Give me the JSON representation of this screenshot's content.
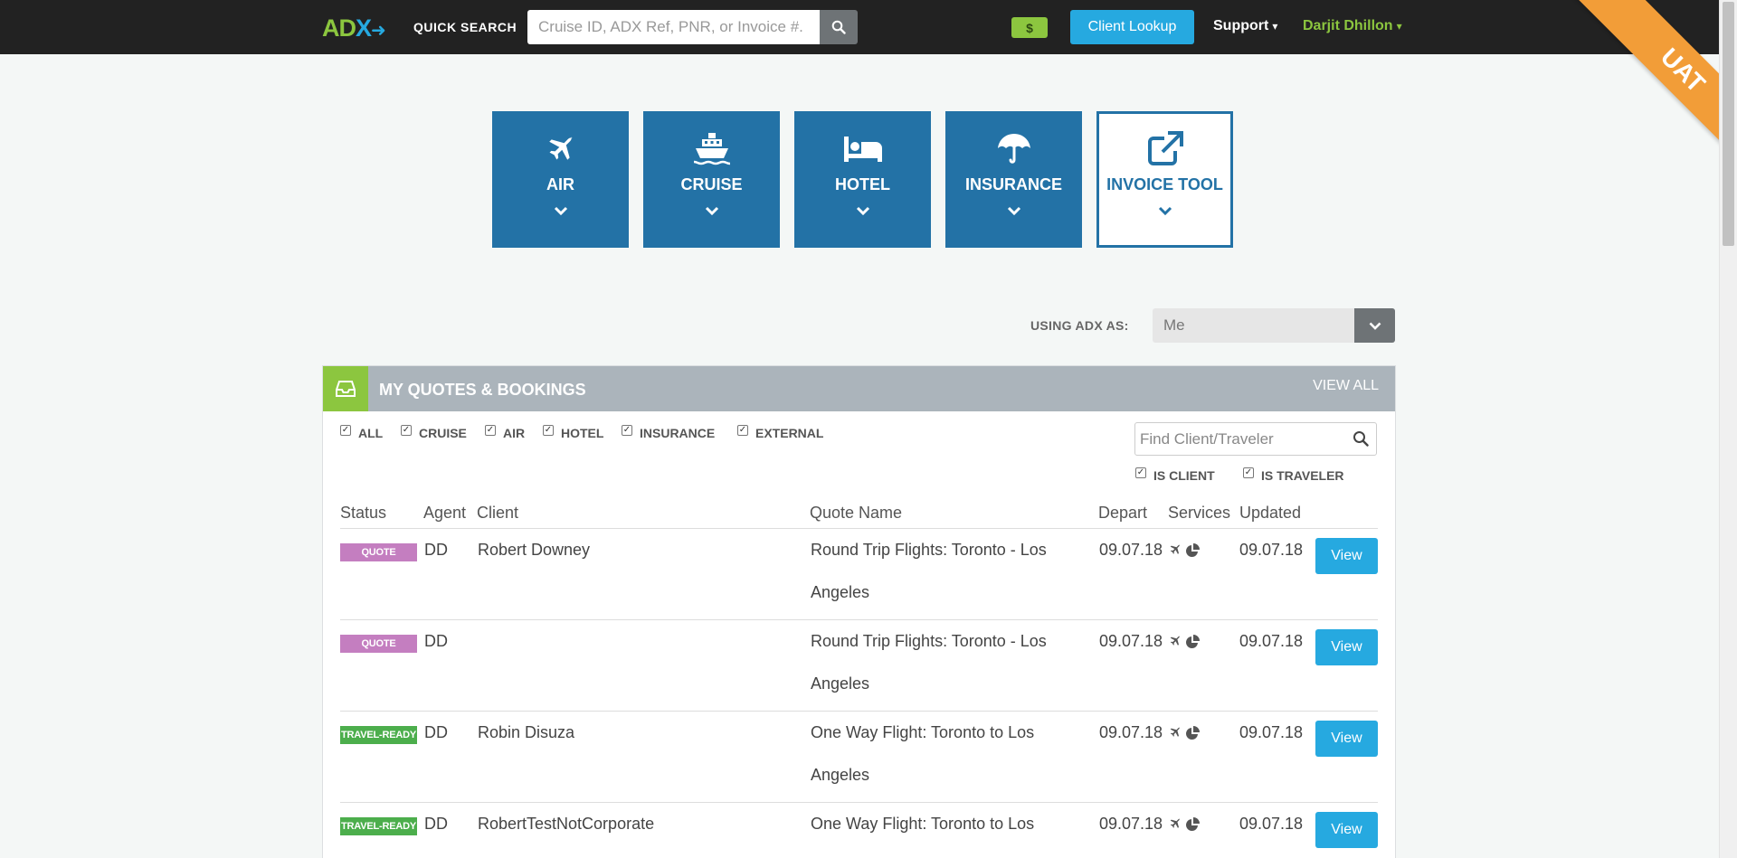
{
  "app": {
    "logo_text": "ADX",
    "ribbon": "UAT"
  },
  "topbar": {
    "quick_search_label": "QUICK SEARCH",
    "quick_search_placeholder": "Cruise ID, ADX Ref, PNR, or Invoice #.",
    "money_label": "$",
    "client_lookup": "Client Lookup",
    "support": "Support",
    "user": "Darjit Dhillon"
  },
  "tiles": [
    {
      "label": "AIR",
      "icon": "plane-icon"
    },
    {
      "label": "CRUISE",
      "icon": "ship-icon"
    },
    {
      "label": "HOTEL",
      "icon": "bed-icon"
    },
    {
      "label": "INSURANCE",
      "icon": "umbrella-icon"
    },
    {
      "label": "INVOICE TOOL",
      "icon": "external-link-icon"
    }
  ],
  "using": {
    "label": "USING ADX AS:",
    "value": "Me"
  },
  "panel": {
    "title": "MY QUOTES & BOOKINGS",
    "view_all": "VIEW ALL",
    "filters": [
      "ALL",
      "CRUISE",
      "AIR",
      "HOTEL",
      "INSURANCE",
      "EXTERNAL"
    ],
    "find_placeholder": "Find Client/Traveler",
    "is_client": "IS CLIENT",
    "is_traveler": "IS TRAVELER",
    "columns": [
      "Status",
      "Agent",
      "Client",
      "Quote Name",
      "Depart",
      "Services",
      "Updated"
    ],
    "rows": [
      {
        "status": "QUOTE",
        "agent": "DD",
        "client": "Robert Downey",
        "quote_name": "Round Trip Flights: Toronto - Los Angeles",
        "depart": "09.07.18",
        "updated": "09.07.18",
        "action": "View"
      },
      {
        "status": "QUOTE",
        "agent": "DD",
        "client": "",
        "quote_name": "Round Trip Flights: Toronto - Los Angeles",
        "depart": "09.07.18",
        "updated": "09.07.18",
        "action": "View"
      },
      {
        "status": "TRAVEL-READY",
        "agent": "DD",
        "client": "Robin Disuza",
        "quote_name": "One Way Flight: Toronto to Los Angeles",
        "depart": "09.07.18",
        "updated": "09.07.18",
        "action": "View"
      },
      {
        "status": "TRAVEL-READY",
        "agent": "DD",
        "client": "RobertTestNotCorporate",
        "quote_name": "One Way Flight: Toronto to Los Angeles",
        "depart": "09.07.18",
        "updated": "09.07.18",
        "action": "View"
      }
    ]
  },
  "colors": {
    "tile_blue": "#2372a6",
    "accent_blue": "#26a9e0",
    "brand_green": "#8cc63f",
    "quote_purple": "#c47ec0",
    "ready_green": "#4cae4c",
    "ribbon_orange": "#f29d38"
  }
}
